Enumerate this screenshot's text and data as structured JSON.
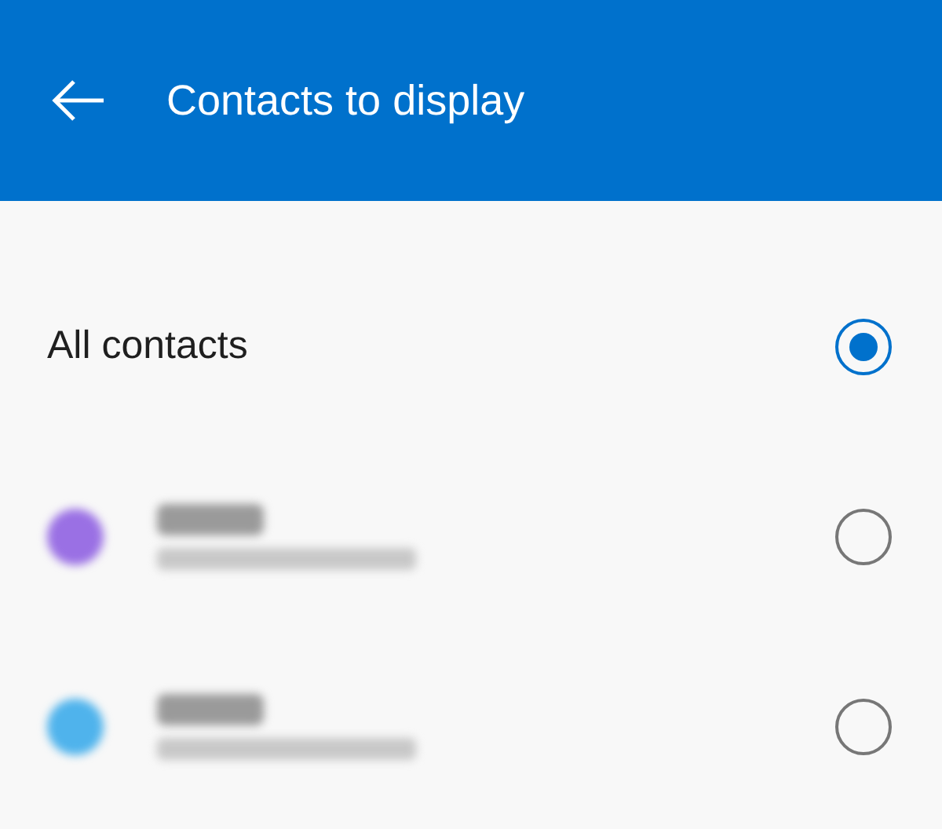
{
  "app_bar": {
    "title": "Contacts to display"
  },
  "options": [
    {
      "kind": "all",
      "label": "All contacts",
      "selected": true
    },
    {
      "kind": "account",
      "color": "#9a70e4",
      "selected": false
    },
    {
      "kind": "account",
      "color": "#4fb3ec",
      "selected": false
    }
  ]
}
